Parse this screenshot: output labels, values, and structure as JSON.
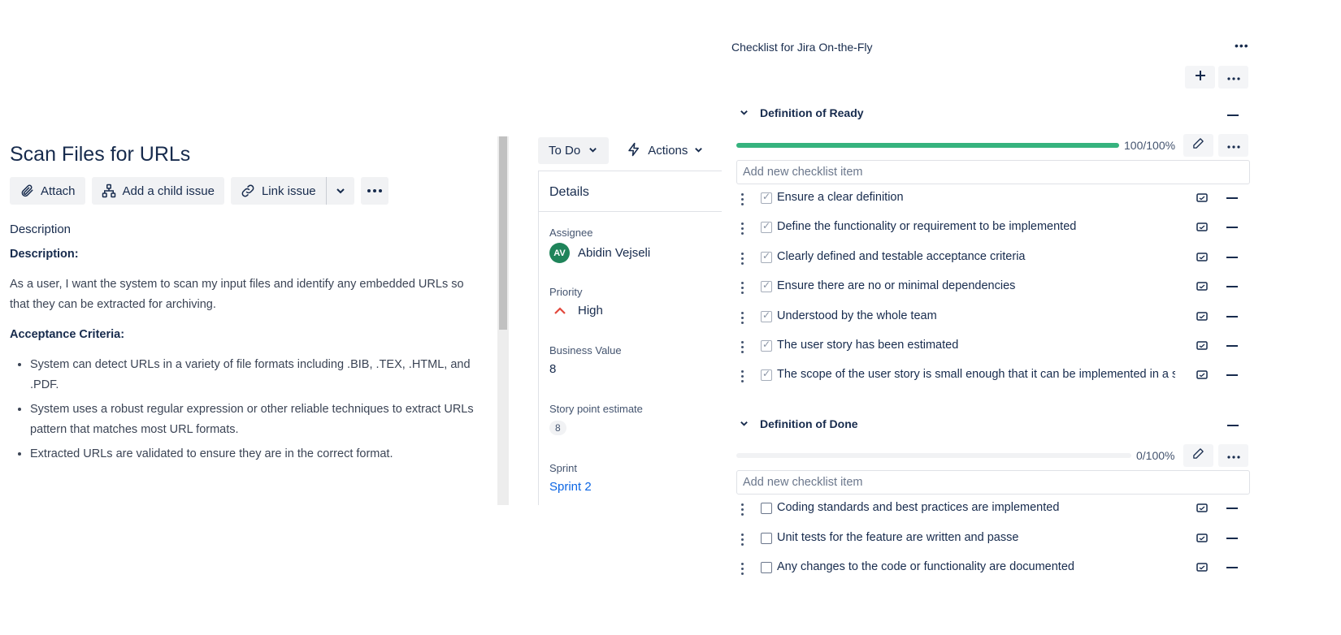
{
  "issue": {
    "title": "Scan Files for URLs",
    "toolbar": {
      "attach": "Attach",
      "add_child": "Add a child issue",
      "link_issue": "Link issue"
    },
    "description_heading": "Description",
    "description": {
      "label": "Description:",
      "text": "As a user, I want the system to scan my input files and identify any embedded URLs so that they can be extracted for archiving.",
      "criteria_label": "Acceptance Criteria:",
      "criteria": [
        "System can detect URLs in a variety of file formats including .BIB, .TEX, .HTML, and .PDF.",
        "System uses a robust regular expression or other reliable techniques to extract URLs pattern that matches most URL formats.",
        "Extracted URLs are validated to ensure they are in the correct format."
      ]
    }
  },
  "details": {
    "status": "To Do",
    "actions": "Actions",
    "heading": "Details",
    "assignee_label": "Assignee",
    "assignee_initials": "AV",
    "assignee_name": "Abidin Vejseli",
    "priority_label": "Priority",
    "priority_value": "High",
    "business_value_label": "Business Value",
    "business_value": "8",
    "story_points_label": "Story point estimate",
    "story_points": "8",
    "sprint_label": "Sprint",
    "sprint_value": "Sprint 2",
    "colors": {
      "assignee_avatar": "#1f845a",
      "priority_high": "#e2483d",
      "link": "#0c66e4"
    }
  },
  "checklist": {
    "title": "Checklist for Jira On-the-Fly",
    "sections": [
      {
        "name": "Definition of Ready",
        "progress_label": "100/100%",
        "progress": 1.0,
        "input_placeholder": "Add new checklist item",
        "items": [
          {
            "text": "Ensure a clear definition",
            "checked": true
          },
          {
            "text": "Define the functionality or requirement to be implemented",
            "checked": true
          },
          {
            "text": "Clearly defined and testable acceptance criteria",
            "checked": true
          },
          {
            "text": "Ensure there are no or minimal dependencies",
            "checked": true
          },
          {
            "text": "Understood by the whole team",
            "checked": true
          },
          {
            "text": "The user story has been estimated",
            "checked": true
          },
          {
            "text": "The scope of the user story is small enough that it can be implemented in a sin",
            "checked": true
          }
        ]
      },
      {
        "name": "Definition of Done",
        "progress_label": "0/100%",
        "progress": 0.0,
        "input_placeholder": "Add new checklist item",
        "items": [
          {
            "text": "Coding standards and best practices are implemented",
            "checked": false
          },
          {
            "text": "Unit tests for the feature are written and passe",
            "checked": false
          },
          {
            "text": "Any changes to the code or functionality are documented",
            "checked": false
          }
        ]
      }
    ],
    "colors": {
      "progress_fill": "#36b37e"
    }
  }
}
